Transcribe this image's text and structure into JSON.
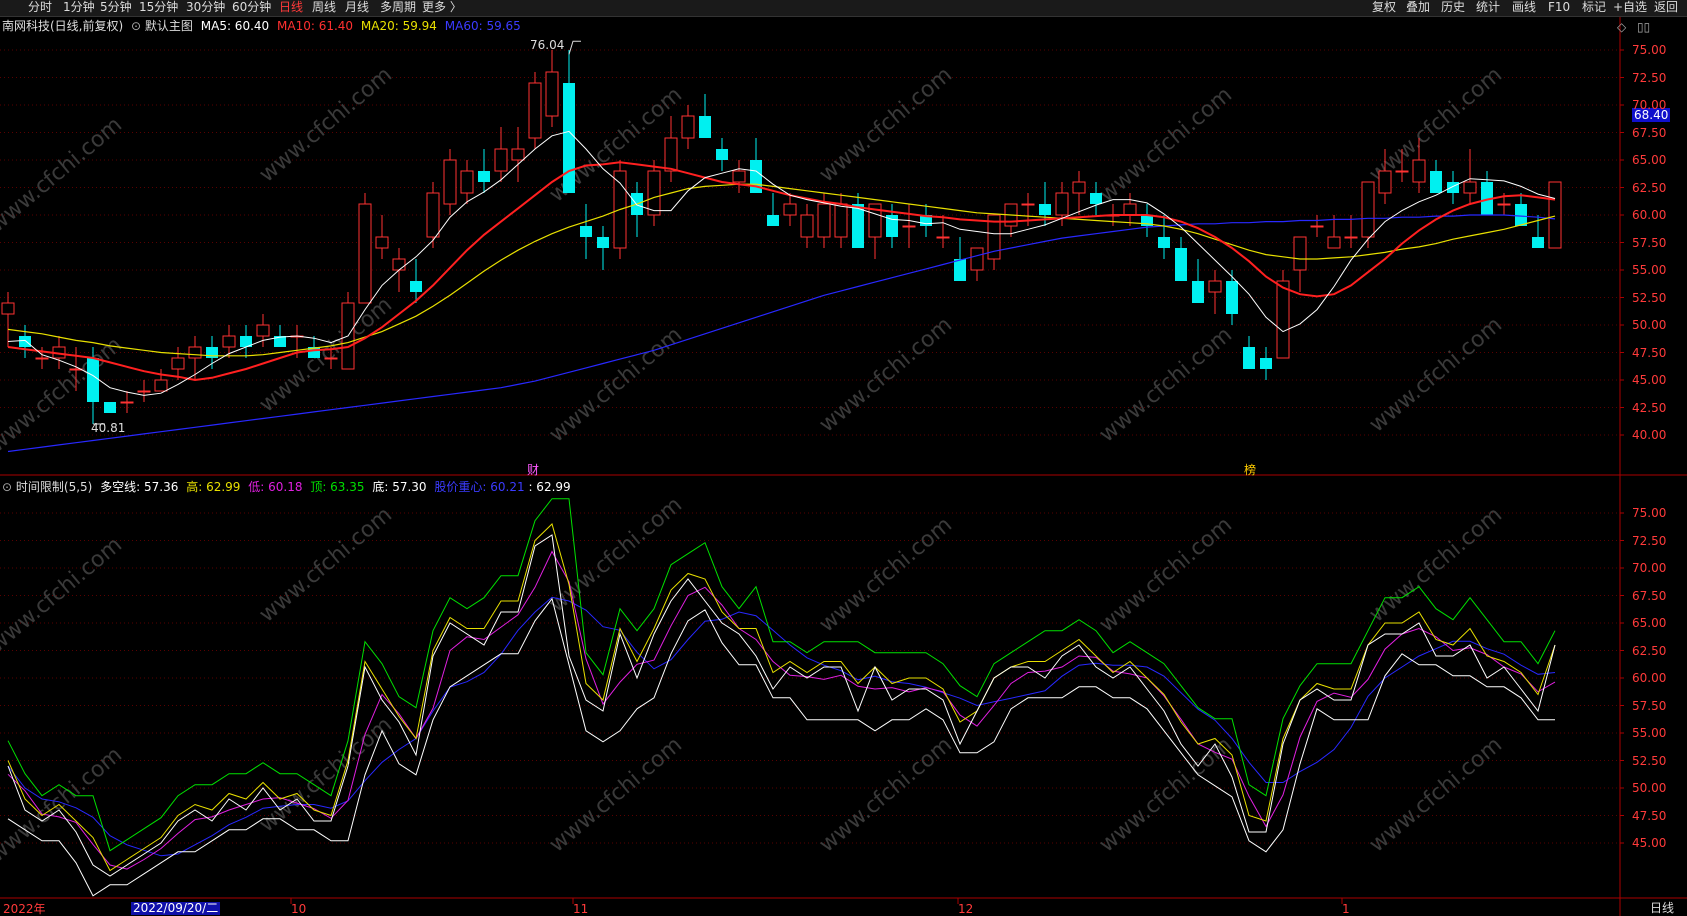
{
  "toolbar_left": [
    "分时",
    "1分钟",
    "5分钟",
    "15分钟",
    "30分钟",
    "60分钟",
    "日线",
    "周线",
    "月线",
    "多周期",
    "更多 〉"
  ],
  "toolbar_active": "日线",
  "toolbar_right": [
    "复权",
    "叠加",
    "历史",
    "统计",
    "画线",
    "F10",
    "标记",
    "+自选",
    "返回"
  ],
  "main_info": {
    "stock": "南网科技(日线,前复权)",
    "toggle": "⊙",
    "template": "默认主图",
    "ma5_label": "MA5: 60.40",
    "ma10_label": "MA10: 61.40",
    "ma20_label": "MA20: 59.94",
    "ma60_label": "MA60: 59.65"
  },
  "sub_info": {
    "toggle": "⊙",
    "name": "时间限制(5,5)",
    "dkx_label": "多空线: 57.36",
    "high_label": "高: 62.99",
    "low_label": "低: 60.18",
    "top_label": "顶: 63.35",
    "bottom_label": "底: 57.30",
    "center_label": "股价重心: 60.21",
    "last_label": ": 62.99"
  },
  "price_axis": [
    "75.00",
    "72.50",
    "70.00",
    "67.50",
    "65.00",
    "62.50",
    "60.00",
    "57.50",
    "55.00",
    "52.50",
    "50.00",
    "47.50",
    "45.00",
    "42.50",
    "40.00"
  ],
  "sub_axis": [
    "75.00",
    "72.50",
    "70.00",
    "67.50",
    "65.00",
    "62.50",
    "60.00",
    "57.50",
    "55.00",
    "52.50",
    "50.00",
    "47.50",
    "45.00"
  ],
  "current_price_tag": "68.40",
  "high_marker": "76.04",
  "low_marker": "40.81",
  "event_markers": [
    "财",
    "榜"
  ],
  "date_axis": [
    "2022年",
    "2022/09/20/二",
    "10",
    "11",
    "12",
    "1"
  ],
  "period_label": "日线",
  "watermark": "www.cfchi.com",
  "colors": {
    "up": "#ff3232",
    "down": "#00f0f0",
    "ma5": "#ffffff",
    "ma10": "#ff2020",
    "ma20": "#e8e000",
    "ma60": "#2828ff",
    "frame": "#aa0000",
    "axis_text": "#ff3a3a",
    "sub_green": "#00e000",
    "sub_magenta": "#e020e0"
  },
  "chart_data": {
    "type": "candlestick",
    "candles": [
      [
        51,
        53,
        48,
        52
      ],
      [
        49,
        50,
        47,
        48
      ],
      [
        47,
        48,
        46,
        47
      ],
      [
        47,
        49,
        46,
        48
      ],
      [
        46,
        48,
        44,
        46
      ],
      [
        47,
        48,
        41,
        43
      ],
      [
        43,
        43,
        42,
        42
      ],
      [
        43,
        44,
        42,
        43
      ],
      [
        44,
        45,
        43,
        44
      ],
      [
        44,
        46,
        44,
        45
      ],
      [
        46,
        48,
        45,
        47
      ],
      [
        47,
        49,
        45,
        48
      ],
      [
        48,
        49,
        46,
        47
      ],
      [
        48,
        50,
        47,
        49
      ],
      [
        49,
        50,
        47,
        48
      ],
      [
        49,
        51,
        48,
        50
      ],
      [
        49,
        50,
        48,
        48
      ],
      [
        49,
        50,
        47,
        49
      ],
      [
        48,
        49,
        47,
        47
      ],
      [
        47,
        48,
        46,
        47
      ],
      [
        46,
        53,
        46,
        52
      ],
      [
        52,
        62,
        52,
        61
      ],
      [
        57,
        60,
        56,
        58
      ],
      [
        55,
        57,
        53,
        56
      ],
      [
        54,
        56,
        52,
        53
      ],
      [
        58,
        63,
        57,
        62
      ],
      [
        61,
        66,
        60,
        65
      ],
      [
        62,
        65,
        61,
        64
      ],
      [
        64,
        66,
        62,
        63
      ],
      [
        64,
        68,
        63,
        66
      ],
      [
        65,
        68,
        63,
        66
      ],
      [
        67,
        73,
        66,
        72
      ],
      [
        69,
        75,
        68,
        73
      ],
      [
        72,
        75,
        62,
        62
      ],
      [
        59,
        61,
        56,
        58
      ],
      [
        58,
        59,
        55,
        57
      ],
      [
        57,
        65,
        56,
        64
      ],
      [
        62,
        63,
        58,
        60
      ],
      [
        60,
        65,
        59,
        64
      ],
      [
        64,
        69,
        63,
        67
      ],
      [
        67,
        70,
        66,
        69
      ],
      [
        69,
        71,
        67,
        67
      ],
      [
        66,
        67,
        64,
        65
      ],
      [
        63,
        65,
        62,
        64
      ],
      [
        65,
        67,
        62,
        62
      ],
      [
        60,
        62,
        59,
        59
      ],
      [
        60,
        62,
        59,
        61
      ],
      [
        58,
        61,
        57,
        60
      ],
      [
        58,
        62,
        57,
        61
      ],
      [
        58,
        62,
        57,
        61
      ],
      [
        61,
        62,
        57,
        57
      ],
      [
        58,
        61,
        56,
        61
      ],
      [
        60,
        61,
        57,
        58
      ],
      [
        59,
        61,
        57,
        59
      ],
      [
        60,
        61,
        58,
        59
      ],
      [
        58,
        60,
        57,
        58
      ],
      [
        56,
        58,
        54,
        54
      ],
      [
        55,
        57,
        54,
        57
      ],
      [
        56,
        60,
        55,
        60
      ],
      [
        59,
        61,
        58,
        61
      ],
      [
        61,
        62,
        59,
        61
      ],
      [
        61,
        63,
        59,
        60
      ],
      [
        60,
        63,
        59,
        62
      ],
      [
        62,
        64,
        60,
        63
      ],
      [
        62,
        63,
        60,
        61
      ],
      [
        60,
        61,
        59,
        60
      ],
      [
        60,
        62,
        59,
        61
      ],
      [
        60,
        61,
        58,
        59
      ],
      [
        58,
        60,
        56,
        57
      ],
      [
        57,
        58,
        54,
        54
      ],
      [
        54,
        56,
        52,
        52
      ],
      [
        53,
        55,
        51,
        54
      ],
      [
        54,
        55,
        50,
        51
      ],
      [
        48,
        49,
        46,
        46
      ],
      [
        47,
        48,
        45,
        46
      ],
      [
        47,
        55,
        47,
        54
      ],
      [
        55,
        58,
        53,
        58
      ],
      [
        59,
        60,
        58,
        59
      ],
      [
        57,
        60,
        57,
        58
      ],
      [
        58,
        60,
        57,
        58
      ],
      [
        58,
        63,
        57,
        63
      ],
      [
        62,
        66,
        61,
        64
      ],
      [
        64,
        66,
        63,
        64
      ],
      [
        63,
        67,
        62,
        65
      ],
      [
        64,
        65,
        62,
        62
      ],
      [
        63,
        64,
        61,
        62
      ],
      [
        62,
        66,
        61,
        63
      ],
      [
        63,
        64,
        60,
        60
      ],
      [
        61,
        62,
        60,
        61
      ],
      [
        61,
        62,
        59,
        59
      ],
      [
        58,
        60,
        57,
        57
      ],
      [
        57,
        63,
        57,
        63
      ]
    ],
    "ma5": [
      48.5,
      48.6,
      47.3,
      46.8,
      46.2,
      45.4,
      44.3,
      43.9,
      43.6,
      43.8,
      44.6,
      45.5,
      46.5,
      47.4,
      48.0,
      48.6,
      48.9,
      49.0,
      48.8,
      48.4,
      49.0,
      51.4,
      53.6,
      55.0,
      56.2,
      57.7,
      59.8,
      61.2,
      62.1,
      63.2,
      64.6,
      66.0,
      67.2,
      67.6,
      66.0,
      64.2,
      62.9,
      60.9,
      60.4,
      60.4,
      62.2,
      63.4,
      63.8,
      64.2,
      64.0,
      62.8,
      61.8,
      61.4,
      61.1,
      60.8,
      60.6,
      60.1,
      59.6,
      59.5,
      59.2,
      59.3,
      58.7,
      58.5,
      58.3,
      58.3,
      58.7,
      59.1,
      59.7,
      60.3,
      60.9,
      61.4,
      61.4,
      61.1,
      60.1,
      58.9,
      57.4,
      55.9,
      54.4,
      52.8,
      50.7,
      49.4,
      50.1,
      51.4,
      53.5,
      55.9,
      57.8,
      59.4,
      60.4,
      61.2,
      61.8,
      62.6,
      63.3,
      63.2,
      63.1,
      62.6,
      61.9,
      61.5
    ],
    "ma10": [
      48.0,
      47.8,
      47.6,
      47.4,
      47.2,
      47.0,
      46.6,
      46.2,
      45.8,
      45.5,
      45.3,
      45.0,
      45.2,
      45.6,
      46.0,
      46.5,
      47.0,
      47.5,
      47.7,
      47.8,
      48.0,
      48.8,
      49.8,
      51.0,
      52.2,
      53.6,
      55.2,
      56.8,
      58.2,
      59.4,
      60.6,
      61.8,
      63.0,
      64.0,
      64.5,
      64.6,
      64.8,
      64.6,
      64.4,
      64.2,
      63.8,
      63.4,
      63.0,
      62.8,
      62.6,
      62.2,
      61.8,
      61.5,
      61.2,
      61.0,
      60.7,
      60.5,
      60.3,
      60.1,
      59.9,
      59.8,
      59.6,
      59.5,
      59.4,
      59.4,
      59.5,
      59.6,
      59.7,
      59.8,
      59.9,
      60.0,
      60.0,
      60.0,
      59.8,
      59.4,
      58.8,
      58.0,
      57.0,
      55.8,
      54.4,
      53.4,
      52.8,
      52.6,
      52.8,
      53.6,
      54.8,
      56.0,
      57.4,
      58.6,
      59.6,
      60.4,
      61.0,
      61.4,
      61.7,
      61.8,
      61.6,
      61.4
    ],
    "ma20": [
      49.6,
      49.4,
      49.2,
      48.9,
      48.6,
      48.4,
      48.1,
      47.9,
      47.7,
      47.5,
      47.4,
      47.3,
      47.2,
      47.2,
      47.2,
      47.3,
      47.5,
      47.7,
      47.9,
      48.1,
      48.4,
      48.9,
      49.4,
      50.1,
      50.8,
      51.7,
      52.7,
      53.8,
      54.9,
      55.9,
      56.8,
      57.6,
      58.3,
      58.9,
      59.4,
      59.9,
      60.5,
      61.0,
      61.6,
      62.0,
      62.4,
      62.6,
      62.7,
      62.8,
      62.8,
      62.6,
      62.4,
      62.2,
      62.0,
      61.8,
      61.6,
      61.4,
      61.2,
      61.0,
      60.8,
      60.6,
      60.4,
      60.2,
      60.1,
      60.0,
      59.9,
      59.8,
      59.7,
      59.6,
      59.5,
      59.4,
      59.3,
      59.2,
      59.0,
      58.7,
      58.3,
      57.8,
      57.3,
      56.8,
      56.4,
      56.2,
      56.0,
      56.0,
      56.1,
      56.2,
      56.4,
      56.6,
      56.9,
      57.1,
      57.4,
      57.8,
      58.1,
      58.4,
      58.7,
      59.1,
      59.5,
      59.9
    ],
    "ma60": [
      38.5,
      38.7,
      38.9,
      39.1,
      39.3,
      39.5,
      39.7,
      39.9,
      40.1,
      40.3,
      40.5,
      40.7,
      40.9,
      41.1,
      41.3,
      41.5,
      41.7,
      41.9,
      42.1,
      42.3,
      42.5,
      42.7,
      42.9,
      43.1,
      43.3,
      43.5,
      43.7,
      43.9,
      44.1,
      44.3,
      44.6,
      44.9,
      45.3,
      45.7,
      46.1,
      46.5,
      46.9,
      47.3,
      47.7,
      48.2,
      48.7,
      49.2,
      49.7,
      50.2,
      50.7,
      51.2,
      51.7,
      52.2,
      52.7,
      53.1,
      53.5,
      53.9,
      54.3,
      54.7,
      55.1,
      55.5,
      55.9,
      56.3,
      56.7,
      57.0,
      57.3,
      57.6,
      57.9,
      58.1,
      58.3,
      58.5,
      58.7,
      58.9,
      59.0,
      59.1,
      59.2,
      59.2,
      59.3,
      59.3,
      59.4,
      59.4,
      59.5,
      59.5,
      59.6,
      59.6,
      59.7,
      59.7,
      59.8,
      59.8,
      59.9,
      59.9,
      60.0,
      60.0,
      60.0,
      59.9,
      59.8,
      59.65
    ]
  }
}
